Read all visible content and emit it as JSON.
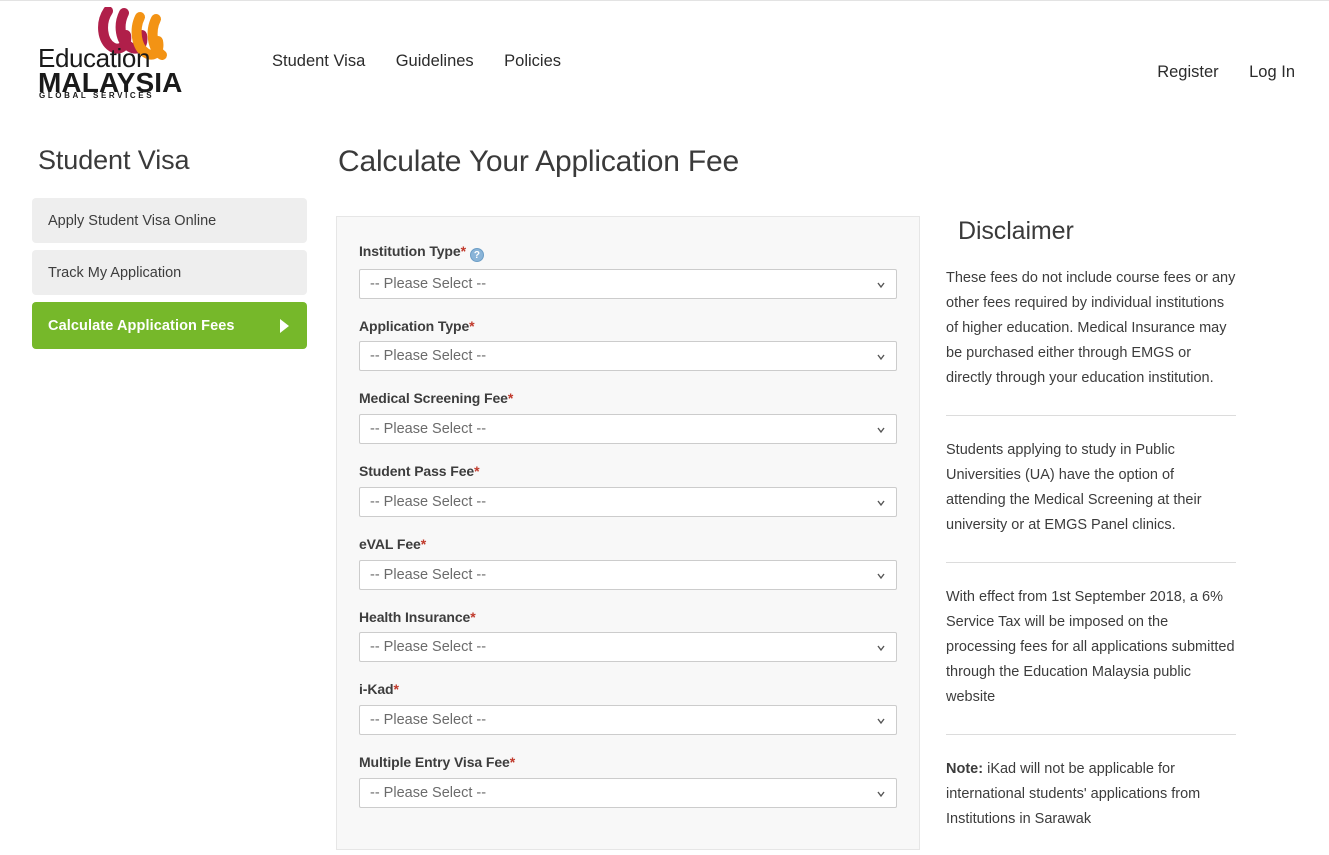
{
  "header": {
    "logo": {
      "line1": "Education",
      "line2": "MALAYSIA",
      "line3": "GLOBAL SERVICES",
      "mark_colors": {
        "left": "#b01f4a",
        "right": "#f39314"
      }
    },
    "nav": [
      {
        "label": "Student Visa"
      },
      {
        "label": "Guidelines"
      },
      {
        "label": "Policies"
      }
    ],
    "account": [
      {
        "label": "Register"
      },
      {
        "label": "Log In"
      }
    ]
  },
  "sidebar": {
    "title": "Student Visa",
    "accent_color": "#76b82a",
    "items": [
      {
        "label": "Apply Student Visa Online",
        "active": false
      },
      {
        "label": "Track My Application",
        "active": false
      },
      {
        "label": "Calculate Application Fees",
        "active": true
      }
    ]
  },
  "main": {
    "title": "Calculate Your Application Fee",
    "placeholder": "-- Please Select --",
    "fields": [
      {
        "label": "Institution Type",
        "required": true,
        "help": true,
        "value": "-- Please Select --"
      },
      {
        "label": "Application Type",
        "required": true,
        "help": false,
        "value": "-- Please Select --"
      },
      {
        "label": "Medical Screening Fee",
        "required": true,
        "help": false,
        "value": "-- Please Select --"
      },
      {
        "label": "Student Pass Fee",
        "required": true,
        "help": false,
        "value": "-- Please Select --"
      },
      {
        "label": "eVAL Fee",
        "required": true,
        "help": false,
        "value": "-- Please Select --"
      },
      {
        "label": "Health Insurance",
        "required": true,
        "help": false,
        "value": "-- Please Select --"
      },
      {
        "label": "i-Kad",
        "required": true,
        "help": false,
        "value": "-- Please Select --"
      },
      {
        "label": "Multiple Entry Visa Fee",
        "required": true,
        "help": false,
        "value": "-- Please Select --"
      }
    ],
    "required_marker": "*",
    "help_glyph": "?"
  },
  "disclaimer": {
    "title": "Disclaimer",
    "paragraphs": [
      "These fees do not include course fees or any other fees required by individual institutions of higher education. Medical Insurance may be purchased either through EMGS or directly through your education institution.",
      "Students applying to study in Public Universities (UA) have the option of attending the Medical Screening at their university or at EMGS Panel clinics.",
      "With effect from 1st September 2018, a 6% Service Tax will be imposed on the processing fees for all applications submitted through the Education Malaysia public website"
    ],
    "note_label": "Note:",
    "note_text": " iKad will not be applicable for international students' applications from Institutions in Sarawak"
  }
}
